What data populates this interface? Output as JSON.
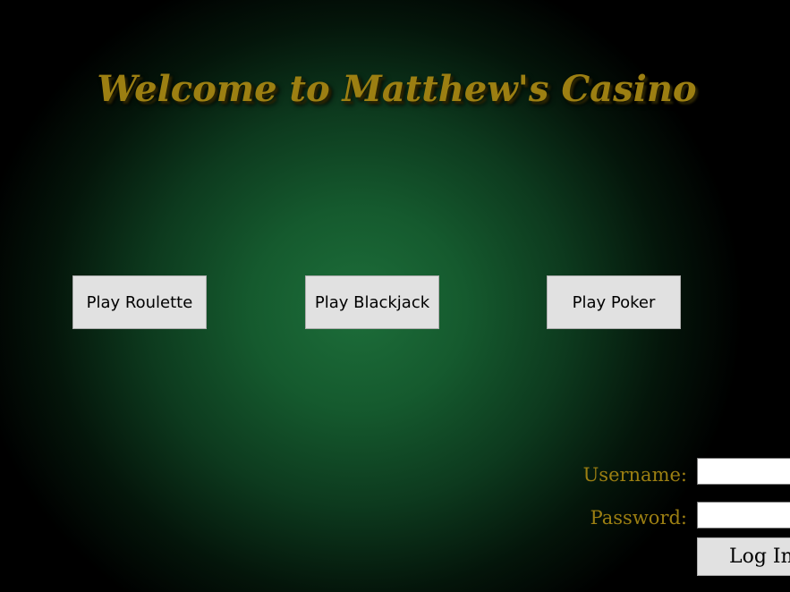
{
  "header": {
    "title": "Welcome to Matthew's Casino"
  },
  "games": {
    "roulette_label": "Play Roulette",
    "blackjack_label": "Play Blackjack",
    "poker_label": "Play Poker"
  },
  "login": {
    "username_label": "Username:",
    "username_value": "",
    "password_label": "Password:",
    "password_value": "",
    "login_button_label": "Log In"
  },
  "colors": {
    "title_gold": "#9c7f12",
    "felt_green": "#1d6e3a",
    "button_gray": "#e1e1e1"
  }
}
